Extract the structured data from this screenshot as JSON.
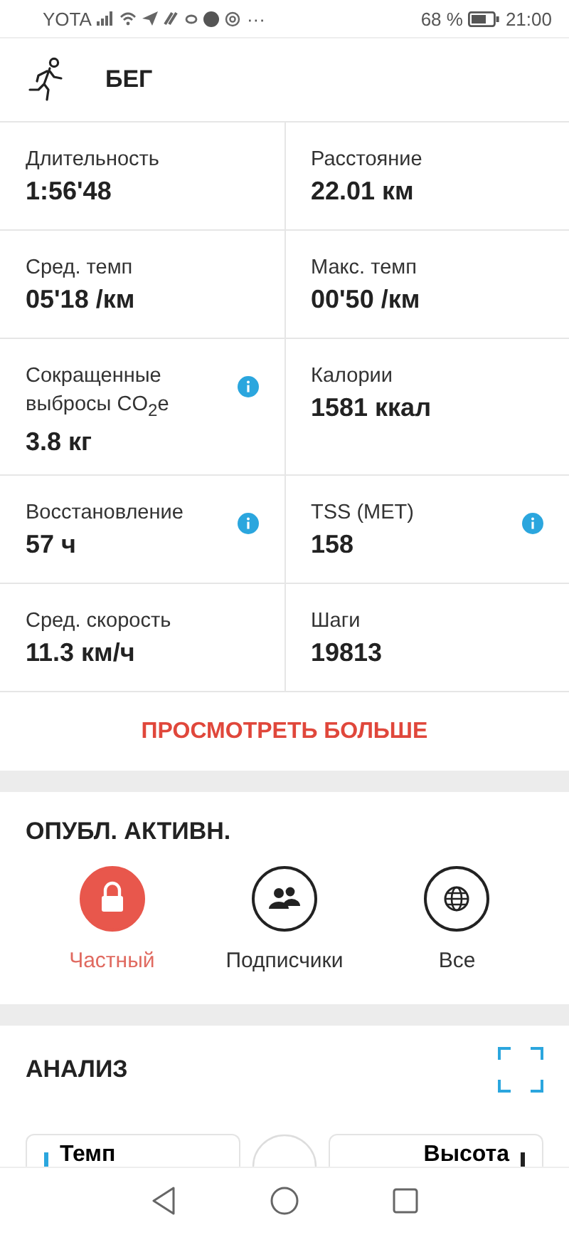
{
  "status_bar": {
    "carrier": "YOTA",
    "more": "···",
    "battery_text": "68 %",
    "time": "21:00"
  },
  "header": {
    "title": "БЕГ"
  },
  "stats": [
    {
      "label": "Длительность",
      "value": "1:56'48",
      "info": false
    },
    {
      "label": "Расстояние",
      "value": "22.01 км",
      "info": false
    },
    {
      "label": "Сред. темп",
      "value": "05'18 /км",
      "info": false
    },
    {
      "label": "Макс. темп",
      "value": "00'50 /км",
      "info": false
    },
    {
      "label": "Сокращенные выбросы CO$_{2}$e",
      "value": "3.8 кг",
      "info": true
    },
    {
      "label": "Калории",
      "value": "1581 ккал",
      "info": false
    },
    {
      "label": "Восстановление",
      "value": "57 ч",
      "info": true
    },
    {
      "label": "TSS (MET)",
      "value": "158",
      "info": true
    },
    {
      "label": "Сред. скорость",
      "value": "11.3 км/ч",
      "info": false
    },
    {
      "label": "Шаги",
      "value": "19813",
      "info": false
    }
  ],
  "more_button": "ПРОСМОТРЕТЬ БОЛЬШЕ",
  "publish": {
    "title": "ОПУБЛ. АКТИВН.",
    "options": [
      {
        "label": "Частный",
        "selected": true
      },
      {
        "label": "Подписчики",
        "selected": false
      },
      {
        "label": "Все",
        "selected": false
      }
    ]
  },
  "analysis": {
    "title": "АНАЛИЗ",
    "left_metric": "Темп",
    "right_metric": "Высота"
  }
}
